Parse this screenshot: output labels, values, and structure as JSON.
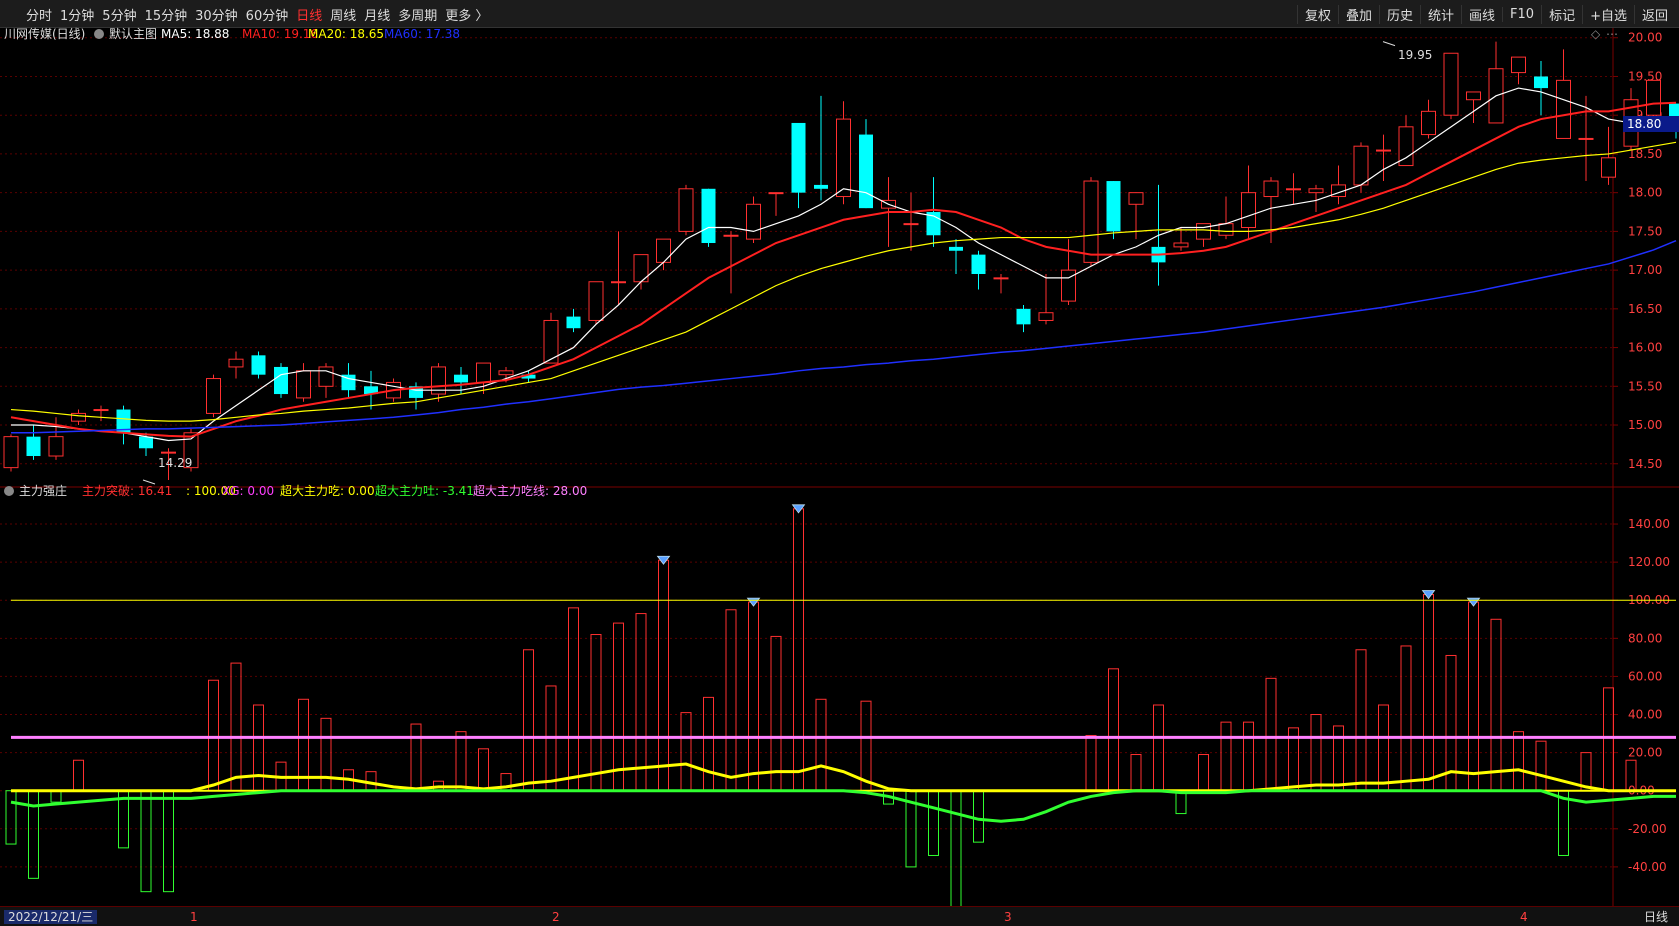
{
  "toolbar": {
    "periods": [
      "分时",
      "1分钟",
      "5分钟",
      "15分钟",
      "30分钟",
      "60分钟",
      "日线",
      "周线",
      "月线",
      "多周期",
      "更多 〉"
    ],
    "active_period": "日线",
    "right_buttons": [
      "复权",
      "叠加",
      "历史",
      "统计",
      "画线",
      "F10",
      "标记",
      "+自选",
      "返回"
    ]
  },
  "main_chart": {
    "stock_name": "川网传媒(日线)",
    "template_label": "默认主图",
    "ma5": {
      "label": "MA5: 18.88",
      "color": "#ffffff"
    },
    "ma10": {
      "label": "MA10: 19.16",
      "color": "#ff2020"
    },
    "ma20": {
      "label": "MA20: 18.65",
      "color": "#ffff00"
    },
    "ma60": {
      "label": "MA60: 17.38",
      "color": "#2030ff"
    },
    "high_label": "19.95",
    "low_label": "14.29",
    "last_price": "18.80",
    "y_ticks": [
      "20.00",
      "19.50",
      "19.00",
      "18.50",
      "18.00",
      "17.50",
      "17.00",
      "16.50",
      "16.00",
      "15.50",
      "15.00",
      "14.50"
    ]
  },
  "sub_chart": {
    "name": "主力强庄",
    "labels": [
      {
        "text": "主力突破: 16.41",
        "color": "#ff3030"
      },
      {
        "text": ": 100.00",
        "color": "#ffff00"
      },
      {
        "text": "XG: 0.00",
        "color": "#ff40ff"
      },
      {
        "text": "超大主力吃: 0.00",
        "color": "#ffff00"
      },
      {
        "text": "超大主力吐: -3.41",
        "color": "#30ff30"
      },
      {
        "text": "超大主力吃线: 28.00",
        "color": "#ff80ff"
      }
    ],
    "y_ticks": [
      "140.00",
      "120.00",
      "100.00",
      "80.00",
      "60.00",
      "40.00",
      "20.00",
      "0.00",
      "-20.00",
      "-40.00"
    ]
  },
  "status": {
    "date": "2022/12/21/三",
    "month_ticks": [
      "1",
      "2",
      "3",
      "4"
    ],
    "period": "日线"
  },
  "colors": {
    "up": "#ff3030",
    "down": "#00ffff",
    "bg": "#000000",
    "grid": "#5a0000"
  },
  "chart_data": [
    {
      "type": "candlestick",
      "ylim": [
        14.2,
        20.1
      ],
      "ohlc": [
        [
          14.45,
          14.85,
          14.4,
          14.88
        ],
        [
          14.85,
          14.6,
          14.55,
          15.0
        ],
        [
          14.6,
          14.85,
          14.55,
          15.1
        ],
        [
          15.05,
          15.15,
          15.0,
          15.2
        ],
        [
          15.2,
          15.2,
          15.05,
          15.25
        ],
        [
          15.2,
          14.9,
          14.75,
          15.25
        ],
        [
          14.85,
          14.7,
          14.6,
          14.9
        ],
        [
          14.65,
          14.65,
          14.29,
          14.7
        ],
        [
          14.45,
          14.9,
          14.4,
          14.95
        ],
        [
          15.15,
          15.6,
          15.1,
          15.65
        ],
        [
          15.75,
          15.85,
          15.6,
          15.95
        ],
        [
          15.9,
          15.65,
          15.6,
          15.95
        ],
        [
          15.75,
          15.4,
          15.35,
          15.8
        ],
        [
          15.35,
          15.7,
          15.3,
          15.8
        ],
        [
          15.5,
          15.75,
          15.35,
          15.8
        ],
        [
          15.65,
          15.45,
          15.35,
          15.8
        ],
        [
          15.5,
          15.4,
          15.2,
          15.7
        ],
        [
          15.35,
          15.55,
          15.3,
          15.6
        ],
        [
          15.5,
          15.35,
          15.2,
          15.55
        ],
        [
          15.4,
          15.75,
          15.3,
          15.8
        ],
        [
          15.65,
          15.55,
          15.4,
          15.75
        ],
        [
          15.55,
          15.8,
          15.4,
          15.8
        ],
        [
          15.65,
          15.7,
          15.55,
          15.75
        ],
        [
          15.65,
          15.6,
          15.55,
          15.7
        ],
        [
          15.8,
          16.35,
          15.8,
          16.45
        ],
        [
          16.4,
          16.25,
          16.2,
          16.5
        ],
        [
          16.35,
          16.85,
          16.3,
          16.85
        ],
        [
          16.85,
          16.85,
          16.55,
          17.5
        ],
        [
          16.85,
          17.2,
          16.75,
          17.2
        ],
        [
          17.1,
          17.4,
          17.0,
          17.4
        ],
        [
          17.5,
          18.05,
          17.45,
          18.1
        ],
        [
          18.05,
          17.35,
          17.3,
          18.05
        ],
        [
          17.45,
          17.45,
          16.7,
          17.5
        ],
        [
          17.4,
          17.85,
          17.35,
          17.95
        ],
        [
          18.0,
          18.0,
          17.7,
          18.0
        ],
        [
          18.9,
          18.0,
          17.8,
          18.9
        ],
        [
          18.1,
          18.05,
          17.9,
          19.25
        ],
        [
          17.95,
          18.95,
          17.85,
          19.18
        ],
        [
          18.75,
          17.8,
          17.8,
          18.95
        ],
        [
          17.8,
          17.9,
          17.3,
          18.2
        ],
        [
          17.6,
          17.6,
          17.25,
          18.0
        ],
        [
          17.75,
          17.45,
          17.3,
          18.2
        ],
        [
          17.3,
          17.25,
          16.95,
          17.4
        ],
        [
          17.2,
          16.95,
          16.75,
          17.25
        ],
        [
          16.9,
          16.9,
          16.7,
          16.95
        ],
        [
          16.5,
          16.3,
          16.2,
          16.55
        ],
        [
          16.35,
          16.45,
          16.3,
          16.95
        ],
        [
          16.6,
          17.0,
          16.55,
          17.4
        ],
        [
          17.1,
          18.15,
          17.05,
          18.2
        ],
        [
          18.15,
          17.5,
          17.4,
          18.15
        ],
        [
          17.85,
          18.0,
          17.4,
          18.0
        ],
        [
          17.3,
          17.1,
          16.8,
          18.1
        ],
        [
          17.3,
          17.35,
          17.25,
          17.55
        ],
        [
          17.4,
          17.6,
          17.3,
          17.6
        ],
        [
          17.45,
          17.6,
          17.4,
          17.95
        ],
        [
          17.55,
          18.0,
          17.4,
          18.35
        ],
        [
          17.95,
          18.15,
          17.35,
          18.2
        ],
        [
          18.05,
          18.05,
          17.85,
          18.25
        ],
        [
          18.0,
          18.05,
          17.75,
          18.1
        ],
        [
          17.95,
          18.1,
          17.85,
          18.35
        ],
        [
          18.1,
          18.6,
          18.0,
          18.65
        ],
        [
          18.55,
          18.55,
          18.15,
          18.75
        ],
        [
          18.35,
          18.85,
          18.35,
          19.0
        ],
        [
          18.75,
          19.05,
          18.7,
          19.2
        ],
        [
          19.0,
          19.8,
          18.95,
          19.8
        ],
        [
          19.2,
          19.3,
          18.9,
          19.2
        ],
        [
          18.9,
          19.6,
          18.9,
          19.95
        ],
        [
          19.55,
          19.75,
          19.4,
          19.75
        ],
        [
          19.5,
          19.35,
          19.0,
          19.7
        ],
        [
          18.7,
          19.45,
          18.8,
          19.85
        ],
        [
          18.7,
          18.7,
          18.15,
          19.25
        ],
        [
          18.2,
          18.45,
          18.1,
          18.85
        ],
        [
          18.6,
          19.2,
          18.55,
          19.35
        ],
        [
          19.0,
          19.45,
          18.8,
          19.45
        ],
        [
          19.15,
          18.8,
          18.7,
          19.15
        ]
      ],
      "series": [
        {
          "name": "MA5",
          "values": [
            15.0,
            15.0,
            14.98,
            14.95,
            14.92,
            14.9,
            14.85,
            14.8,
            14.82,
            15.05,
            15.25,
            15.45,
            15.65,
            15.7,
            15.7,
            15.6,
            15.55,
            15.5,
            15.45,
            15.45,
            15.45,
            15.5,
            15.6,
            15.7,
            15.85,
            16.0,
            16.3,
            16.55,
            16.85,
            17.1,
            17.4,
            17.55,
            17.55,
            17.5,
            17.6,
            17.7,
            17.85,
            18.05,
            18.0,
            17.85,
            17.75,
            17.7,
            17.55,
            17.35,
            17.2,
            17.05,
            16.9,
            16.9,
            17.05,
            17.2,
            17.3,
            17.45,
            17.55,
            17.55,
            17.6,
            17.7,
            17.8,
            17.85,
            17.9,
            18.0,
            18.1,
            18.3,
            18.45,
            18.65,
            18.85,
            19.05,
            19.25,
            19.35,
            19.3,
            19.2,
            19.1,
            18.95,
            18.9,
            18.88,
            18.88
          ]
        },
        {
          "name": "MA10",
          "values": [
            15.1,
            15.05,
            15.0,
            14.95,
            14.92,
            14.9,
            14.88,
            14.86,
            14.85,
            14.95,
            15.05,
            15.12,
            15.2,
            15.25,
            15.3,
            15.35,
            15.4,
            15.45,
            15.48,
            15.5,
            15.52,
            15.55,
            15.58,
            15.65,
            15.75,
            15.85,
            16.0,
            16.15,
            16.3,
            16.5,
            16.7,
            16.9,
            17.05,
            17.2,
            17.35,
            17.45,
            17.55,
            17.65,
            17.7,
            17.75,
            17.75,
            17.78,
            17.75,
            17.65,
            17.55,
            17.4,
            17.3,
            17.25,
            17.2,
            17.2,
            17.2,
            17.2,
            17.22,
            17.25,
            17.3,
            17.4,
            17.5,
            17.6,
            17.7,
            17.8,
            17.9,
            18.0,
            18.1,
            18.25,
            18.4,
            18.55,
            18.7,
            18.85,
            18.95,
            19.0,
            19.05,
            19.05,
            19.1,
            19.15,
            19.16
          ]
        },
        {
          "name": "MA20",
          "values": [
            15.2,
            15.18,
            15.15,
            15.12,
            15.1,
            15.08,
            15.06,
            15.05,
            15.05,
            15.07,
            15.1,
            15.13,
            15.15,
            15.18,
            15.2,
            15.22,
            15.25,
            15.28,
            15.3,
            15.35,
            15.4,
            15.45,
            15.5,
            15.55,
            15.6,
            15.7,
            15.8,
            15.9,
            16.0,
            16.1,
            16.2,
            16.35,
            16.5,
            16.65,
            16.8,
            16.92,
            17.02,
            17.1,
            17.18,
            17.25,
            17.3,
            17.35,
            17.38,
            17.4,
            17.42,
            17.42,
            17.42,
            17.42,
            17.45,
            17.48,
            17.5,
            17.52,
            17.52,
            17.52,
            17.5,
            17.5,
            17.52,
            17.55,
            17.6,
            17.65,
            17.72,
            17.8,
            17.9,
            18.0,
            18.1,
            18.2,
            18.3,
            18.38,
            18.42,
            18.45,
            18.48,
            18.5,
            18.55,
            18.6,
            18.65
          ]
        },
        {
          "name": "MA60",
          "values": [
            14.9,
            14.9,
            14.91,
            14.92,
            14.93,
            14.94,
            14.95,
            14.95,
            14.96,
            14.97,
            14.98,
            14.99,
            15.0,
            15.02,
            15.04,
            15.06,
            15.08,
            15.1,
            15.13,
            15.16,
            15.2,
            15.23,
            15.27,
            15.3,
            15.34,
            15.38,
            15.42,
            15.46,
            15.49,
            15.51,
            15.54,
            15.57,
            15.6,
            15.63,
            15.66,
            15.7,
            15.73,
            15.75,
            15.78,
            15.8,
            15.83,
            15.85,
            15.88,
            15.91,
            15.94,
            15.96,
            15.99,
            16.02,
            16.05,
            16.08,
            16.11,
            16.14,
            16.17,
            16.2,
            16.24,
            16.28,
            16.32,
            16.36,
            16.4,
            16.44,
            16.48,
            16.52,
            16.57,
            16.62,
            16.67,
            16.72,
            16.78,
            16.84,
            16.9,
            16.96,
            17.02,
            17.08,
            17.17,
            17.26,
            17.38
          ]
        }
      ]
    },
    {
      "type": "bar",
      "ylim": [
        -60,
        150
      ],
      "series": [
        {
          "name": "主力突破",
          "values": [
            0,
            0,
            0,
            16,
            0,
            0,
            0,
            0,
            0,
            58,
            67,
            45,
            15,
            48,
            38,
            11,
            10,
            0,
            35,
            5,
            31,
            22,
            9,
            74,
            55,
            96,
            82,
            88,
            93,
            121,
            41,
            49,
            95,
            99,
            81,
            148,
            48,
            0,
            47,
            0,
            0,
            0,
            0,
            0,
            0,
            0,
            0,
            0,
            29,
            64,
            19,
            45,
            0,
            19,
            36,
            36,
            59,
            33,
            40,
            34,
            74,
            45,
            76,
            103,
            71,
            99,
            90,
            31,
            26,
            0,
            20,
            54,
            16,
            0,
            0
          ]
        },
        {
          "name": "超大主力吐",
          "values": [
            -28,
            -46,
            -6,
            0,
            0,
            -30,
            -53,
            -53,
            0,
            0,
            0,
            0,
            0,
            0,
            0,
            0,
            0,
            0,
            0,
            0,
            0,
            0,
            0,
            0,
            0,
            0,
            0,
            0,
            0,
            0,
            0,
            0,
            0,
            0,
            0,
            0,
            0,
            0,
            0,
            -7,
            -40,
            -34,
            -67,
            -27,
            0,
            0,
            0,
            0,
            0,
            0,
            0,
            0,
            -12,
            0,
            0,
            0,
            0,
            0,
            0,
            0,
            0,
            0,
            0,
            0,
            0,
            0,
            0,
            0,
            0,
            -34,
            0,
            0,
            0,
            0,
            0
          ]
        },
        {
          "name": "超大主力吃",
          "values": [
            0,
            0,
            0,
            0,
            0,
            0,
            0,
            0,
            0,
            3,
            7,
            8,
            7,
            7,
            7,
            6,
            4,
            2,
            1,
            2,
            2,
            1,
            2,
            4,
            5,
            7,
            9,
            11,
            12,
            13,
            14,
            10,
            7,
            9,
            10,
            10,
            13,
            10,
            5,
            1,
            0,
            0,
            0,
            0,
            0,
            0,
            0,
            0,
            0,
            0,
            0,
            0,
            0,
            0,
            0,
            0,
            1,
            2,
            3,
            3,
            4,
            4,
            5,
            6,
            10,
            9,
            10,
            11,
            8,
            5,
            2,
            0,
            0,
            0,
            0
          ]
        },
        {
          "name": "超大主力吐线",
          "values": [
            -6,
            -8,
            -7,
            -6,
            -5,
            -4,
            -4,
            -4,
            -4,
            -3,
            -2,
            -1,
            0,
            0,
            0,
            0,
            0,
            0,
            0,
            0,
            0,
            0,
            0,
            0,
            0,
            0,
            0,
            0,
            0,
            0,
            0,
            0,
            0,
            0,
            0,
            0,
            0,
            0,
            -1,
            -3,
            -6,
            -9,
            -12,
            -15,
            -16,
            -15,
            -11,
            -6,
            -3,
            -1,
            0,
            0,
            -1,
            -1,
            -1,
            0,
            0,
            0,
            0,
            0,
            0,
            0,
            0,
            0,
            0,
            0,
            0,
            0,
            0,
            -4,
            -6,
            -5,
            -4,
            -3,
            -3
          ]
        }
      ],
      "hlines": [
        {
          "name": "超大主力吃线",
          "value": 28,
          "color": "#ff80ff"
        },
        {
          "name": "100",
          "value": 100,
          "color": "#ffff00"
        }
      ]
    }
  ]
}
